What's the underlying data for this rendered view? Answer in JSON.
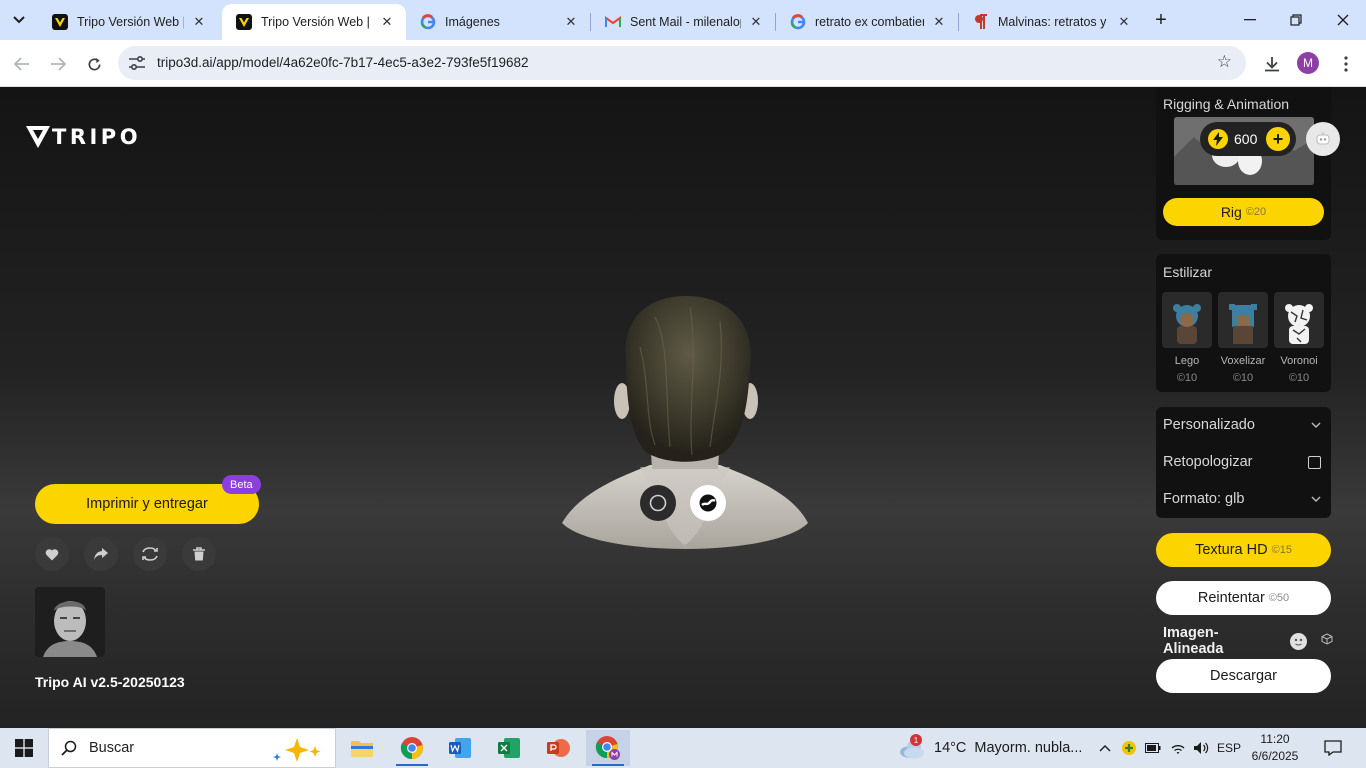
{
  "browser": {
    "tabs": [
      {
        "title": "Tripo Versión Web | D",
        "icon": "tripo-icon",
        "active": false
      },
      {
        "title": "Tripo Versión Web | D",
        "icon": "tripo-icon",
        "active": true
      },
      {
        "title": "Imágenes",
        "icon": "google-icon",
        "active": false
      },
      {
        "title": "Sent Mail - milenalop",
        "icon": "gmail-icon",
        "active": false
      },
      {
        "title": "retrato ex combatien",
        "icon": "google-icon",
        "active": false
      },
      {
        "title": "Malvinas: retratos y p",
        "icon": "pilcrow-icon",
        "active": false
      }
    ],
    "url": "tripo3d.ai/app/model/4a62e0fc-7b17-4ec5-a3e2-793fe5f19682",
    "profile_initial": "M"
  },
  "app": {
    "logo_text": "TRIPO",
    "print_button": "Imprimir y entregar",
    "beta_badge": "Beta",
    "model_version": "Tripo AI v2.5-20250123",
    "credits": "600",
    "rigging": {
      "title": "Rigging & Animation",
      "button": "Rig",
      "cost": "©20"
    },
    "stylize": {
      "title": "Estilizar",
      "items": [
        {
          "label": "Lego",
          "cost": "©10"
        },
        {
          "label": "Voxelizar",
          "cost": "©10"
        },
        {
          "label": "Voronoi",
          "cost": "©10"
        }
      ]
    },
    "options": {
      "custom": "Personalizado",
      "retopo": "Retopologizar",
      "retopo_checked": false,
      "format": "Formato: glb"
    },
    "texture_hd": {
      "label": "Textura HD",
      "cost": "©15"
    },
    "retry": {
      "label": "Reintentar",
      "cost": "©50"
    },
    "aligned_image": "Imagen-Alineada",
    "download": "Descargar",
    "colors": {
      "accent": "#fcd400",
      "beta": "#8b3fe0"
    }
  },
  "taskbar": {
    "search_placeholder": "Buscar",
    "weather_temp": "14°C",
    "weather_text": "Mayorm. nubla...",
    "weather_badge": "1",
    "language": "ESP",
    "time": "11:20",
    "date": "6/6/2025"
  }
}
